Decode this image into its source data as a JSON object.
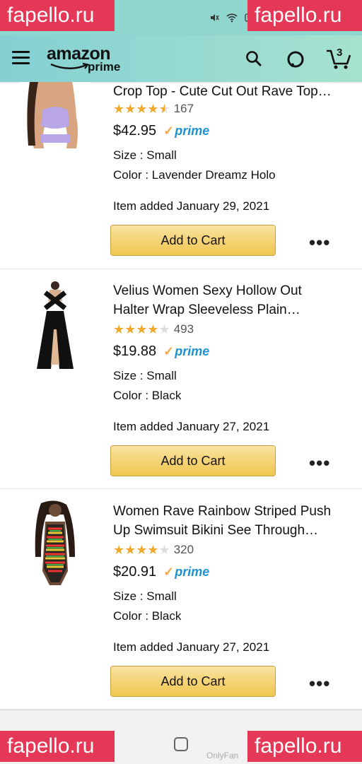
{
  "watermark": "fapello.ru",
  "watermark_footer": "OnlyFan",
  "header": {
    "brand": "amazon",
    "brand_sub": "prime",
    "cart_count": "3"
  },
  "status": {
    "icons": [
      "mute-icon",
      "wifi-icon",
      "volte-icon"
    ]
  },
  "items": [
    {
      "title": "Crop Top - Cute Cut Out Rave Top…",
      "rating": 4.5,
      "stars": "★★★★★",
      "reviews": "167",
      "price": "$42.95",
      "prime": "prime",
      "size": "Size : Small",
      "color": "Color : Lavender Dreamz Holo",
      "added": "Item added January 29, 2021",
      "button": "Add to Cart",
      "more": "•••"
    },
    {
      "title_line1": "Velius Women Sexy Hollow Out",
      "title_line2": "Halter Wrap Sleeveless Plain…",
      "rating": 4.0,
      "stars": "★★★★★",
      "reviews": "493",
      "price": "$19.88",
      "prime": "prime",
      "size": "Size : Small",
      "color": "Color : Black",
      "added": "Item added January 27, 2021",
      "button": "Add to Cart",
      "more": "•••"
    },
    {
      "title_line1": "Women Rave Rainbow Striped Push",
      "title_line2": "Up Swimsuit Bikini See Through…",
      "rating": 4.0,
      "stars": "★★★★★",
      "reviews": "320",
      "price": "$20.91",
      "prime": "prime",
      "size": "Size : Small",
      "color": "Color : Black",
      "added": "Item added January 27, 2021",
      "button": "Add to Cart",
      "more": "•••"
    }
  ],
  "colors": {
    "star": "#f0a92b",
    "prime": "#1f93d1",
    "button": "#f1c550",
    "watermark": "#e53856"
  }
}
